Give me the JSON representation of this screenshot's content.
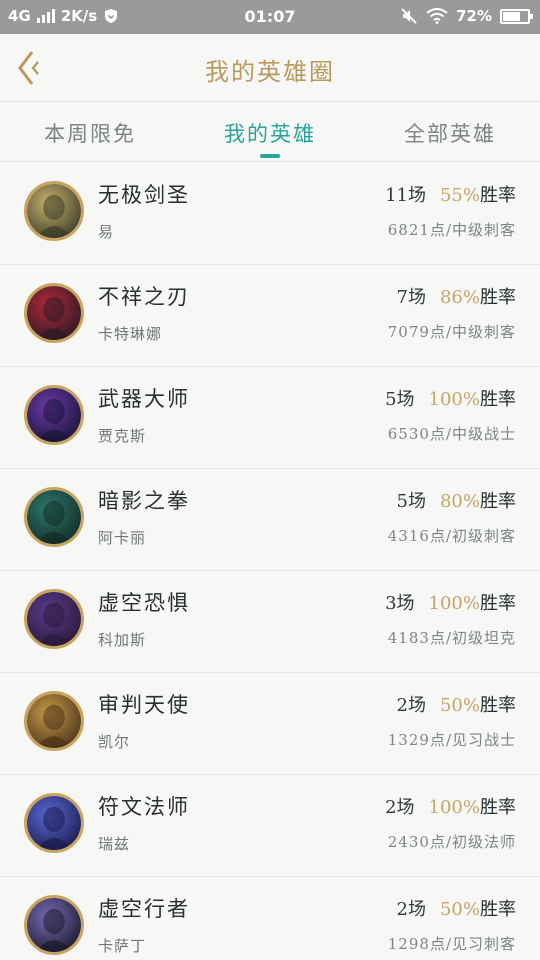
{
  "status_bar": {
    "network": "4G",
    "speed": "2K/s",
    "time": "01:07",
    "battery": "72%",
    "battery_level": 0.72
  },
  "header": {
    "title": "我的英雄圈",
    "back_icon": "chevron-left-icon"
  },
  "tabs": [
    {
      "label": "本周限免",
      "active": false
    },
    {
      "label": "我的英雄",
      "active": true
    },
    {
      "label": "全部英雄",
      "active": false
    }
  ],
  "colors": {
    "accent": "#2aa39a",
    "gold": "#b89a5e",
    "rate": "#c2a56a"
  },
  "heroes": [
    {
      "name": "无极剑圣",
      "alias": "易",
      "games": "11场",
      "rate": "55%",
      "rate_label": "胜率",
      "points_class": "6821点/中级刺客",
      "avatar_colors": [
        "#c8b36a",
        "#3a3a2a"
      ]
    },
    {
      "name": "不祥之刃",
      "alias": "卡特琳娜",
      "games": "7场",
      "rate": "86%",
      "rate_label": "胜率",
      "points_class": "7079点/中级刺客",
      "avatar_colors": [
        "#b0283a",
        "#2a1a24"
      ]
    },
    {
      "name": "武器大师",
      "alias": "贾克斯",
      "games": "5场",
      "rate": "100%",
      "rate_label": "胜率",
      "points_class": "6530点/中级战士",
      "avatar_colors": [
        "#6a3aa8",
        "#1a1438"
      ]
    },
    {
      "name": "暗影之拳",
      "alias": "阿卡丽",
      "games": "5场",
      "rate": "80%",
      "rate_label": "胜率",
      "points_class": "4316点/初级刺客",
      "avatar_colors": [
        "#2a7a6a",
        "#142a28"
      ]
    },
    {
      "name": "虚空恐惧",
      "alias": "科加斯",
      "games": "3场",
      "rate": "100%",
      "rate_label": "胜率",
      "points_class": "4183点/初级坦克",
      "avatar_colors": [
        "#5a3a8a",
        "#2a1a3a"
      ]
    },
    {
      "name": "审判天使",
      "alias": "凯尔",
      "games": "2场",
      "rate": "50%",
      "rate_label": "胜率",
      "points_class": "1329点/见习战士",
      "avatar_colors": [
        "#c89a4a",
        "#4a3218"
      ]
    },
    {
      "name": "符文法师",
      "alias": "瑞兹",
      "games": "2场",
      "rate": "100%",
      "rate_label": "胜率",
      "points_class": "2430点/初级法师",
      "avatar_colors": [
        "#5a6ad8",
        "#1a1a4a"
      ]
    },
    {
      "name": "虚空行者",
      "alias": "卡萨丁",
      "games": "2场",
      "rate": "50%",
      "rate_label": "胜率",
      "points_class": "1298点/见习刺客",
      "avatar_colors": [
        "#7a6ab8",
        "#1a1a2a"
      ]
    }
  ]
}
